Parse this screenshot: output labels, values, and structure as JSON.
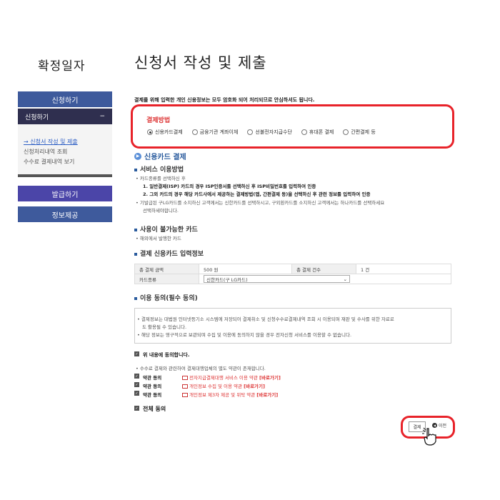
{
  "sidebar": {
    "title": "확정일자",
    "apply_button": "신청하기",
    "sub_header": "신청하기",
    "sub_toggle": "−",
    "menu": [
      "→ 신청서 작성 및 제출",
      "신청처리내역 조회",
      "수수료 결제내역 보기"
    ],
    "issue_button": "발급하기",
    "info_button": "정보제공"
  },
  "main": {
    "title": "신청서 작성 및 제출",
    "notice": "결제를 위해 입력한 개인 신용정보는 모두 암호화 되어 처리되므로 안심하셔도 됩니다.",
    "payment": {
      "label": "결제방법",
      "options": [
        "신용카드결제",
        "금융기관 계좌이체",
        "선불전자지급수단",
        "휴대폰 결제",
        "간편결제 등"
      ],
      "selected": "신용카드결제"
    },
    "card_section_title": "신용카드 결제",
    "service": {
      "heading": "서비스 이용방법",
      "lines": [
        "• 카드종류를 선택하신 후",
        "1. 일반결제(ISP) 카드의 경우 ISP인증서를 선택하신 후 ISP비밀번호를 입력하여 인증",
        "2. 그외 카드의 경우 해당 카드사에서 제공하는 결제방법(앱, 간편결제 등)을 선택하신 후 관련 정보를 입력하여 인증",
        "• 기발급된 구LG카드를 소지하신 고객께서는 신한카드를 선택하시고, 구외환카드를 소지하신 고객께서는 하나카드를 선택하세요",
        "선택하세야합니다."
      ]
    },
    "unavailable": {
      "heading": "사용이 불가능한 카드",
      "line": "• 해외에서 발행한 카드"
    },
    "card_info": {
      "heading": "결제 신용카드 입력정보",
      "total_amount_label": "총 결제 금액",
      "total_amount": "500 원",
      "total_count_label": "총 결제 건수",
      "total_count": "1 건",
      "card_type_label": "카드종류",
      "card_type": "신한카드(구 LG카드)",
      "select_arrow": "⌄"
    },
    "consent": {
      "heading": "이용 동의(필수 동의)",
      "box_lines": [
        "• 결제정보는 대법원 인터넷등기소 시스템에 저장되어 결제취소 및 신청수수료결제내역 조회 시 이용되며 재판 및 수사를 위한 자료로",
        "도 활용될 수 있습니다.",
        "• 해당 정보는 영구적으로 보관되며 수집 및 이용에 동의하지 않을 경우 전자신청 서비스를 이용할 수 없습니다."
      ],
      "agree_above": "위 내용에 동의합니다.",
      "fee_note": "• 수수료 결제와 관련하여 결제대행업체의 별도 약관이 존재합니다.",
      "terms": [
        {
          "label": "약관 동의",
          "text": "전자지급결제대행 서비스 이용 약관",
          "link": "[바로가기]"
        },
        {
          "label": "약관 동의",
          "text": "개인정보 수집 및 이용 약관",
          "link": "[바로가기]"
        },
        {
          "label": "약관 동의",
          "text": "개인정보 제3자 제공 및 위탁 약관",
          "link": "[바로가기]"
        }
      ],
      "agree_all": "전체 동의"
    },
    "buttons": {
      "pay": "결제",
      "prev": "이전"
    }
  },
  "icons": {
    "arrow": "arrow-right-circle-icon",
    "check": "checkbox-checked-icon",
    "book": "book-icon",
    "hand": "pointing-hand-icon"
  }
}
